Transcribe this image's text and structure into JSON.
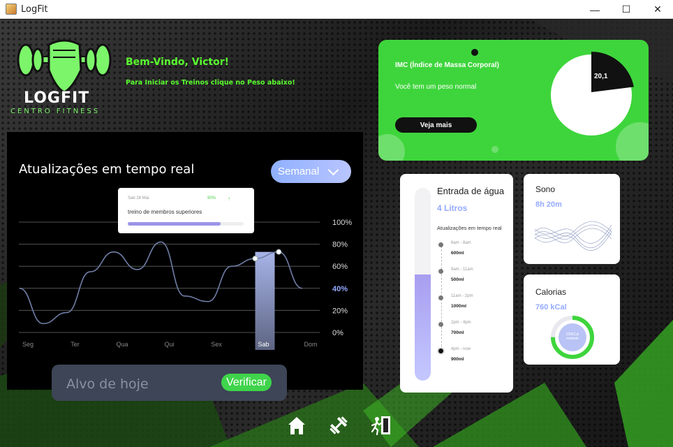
{
  "window": {
    "title": "LogFit",
    "controls": {
      "minimize": "—",
      "maximize": "☐",
      "close": "✕"
    }
  },
  "brand": {
    "name": "LOGFIT",
    "subtitle": "CENTRO FITNESS"
  },
  "header": {
    "welcome": "Bem-Vindo, Victor!",
    "instruction": "Para Iniciar os Treinos clique no Peso abaixo!"
  },
  "updates": {
    "title": "Atualizações em tempo real",
    "period": "Semanal",
    "tooltip": {
      "date": "Sab 28 Mai",
      "percent": "90%",
      "arrow": "↑",
      "label": "treino de membros superiores",
      "progress": 0.8
    },
    "goal": {
      "label": "Alvo de hoje",
      "button": "Verificar"
    }
  },
  "chart_data": {
    "type": "line",
    "categories": [
      "Seg",
      "Ter",
      "Qua",
      "Qui",
      "Sex",
      "Sab",
      "Dom"
    ],
    "highlight_category": "Sab",
    "highlight_tick": "40%",
    "y_ticks": [
      "100%",
      "80%",
      "60%",
      "40%",
      "20%",
      "0%"
    ],
    "ylim": [
      0,
      100
    ],
    "grid": true,
    "series": [
      {
        "x": [
          0,
          0.5,
          1,
          1.5,
          2,
          2.5,
          3,
          3.5,
          4,
          4.5,
          5,
          5.5,
          6
        ],
        "values": [
          40,
          8,
          18,
          55,
          73,
          57,
          82,
          33,
          28,
          60,
          67,
          73,
          40
        ]
      }
    ]
  },
  "imc": {
    "title": "IMC (Índice de Massa Corporal)",
    "message": "Você tem um peso normal",
    "button": "Veja mais",
    "value": "20,1",
    "fraction": 0.22
  },
  "water": {
    "title": "Entrada de água",
    "amount": "4 Litros",
    "subtitle": "Atualizações em tempo real",
    "level": 0.55,
    "entries": [
      {
        "time": "6am - 8am",
        "volume": "600ml"
      },
      {
        "time": "9am - 11am",
        "volume": "500ml"
      },
      {
        "time": "11am - 2pm",
        "volume": "1000ml"
      },
      {
        "time": "2pm - 4pm",
        "volume": "700ml"
      },
      {
        "time": "4pm - now",
        "volume": "900ml"
      }
    ]
  },
  "sleep": {
    "title": "Sono",
    "value": "8h 20m"
  },
  "calories": {
    "title": "Calorias",
    "value": "760 kCal",
    "ring_line1": "230kCal",
    "ring_line2": "restante",
    "ring_fraction": 0.75
  },
  "nav": {
    "icons": [
      "home-icon",
      "dumbbell-icon",
      "exit-icon"
    ]
  },
  "colors": {
    "accent_green": "#3ed53c",
    "text_green": "#59ff2e",
    "blue": "#93a9ff"
  }
}
